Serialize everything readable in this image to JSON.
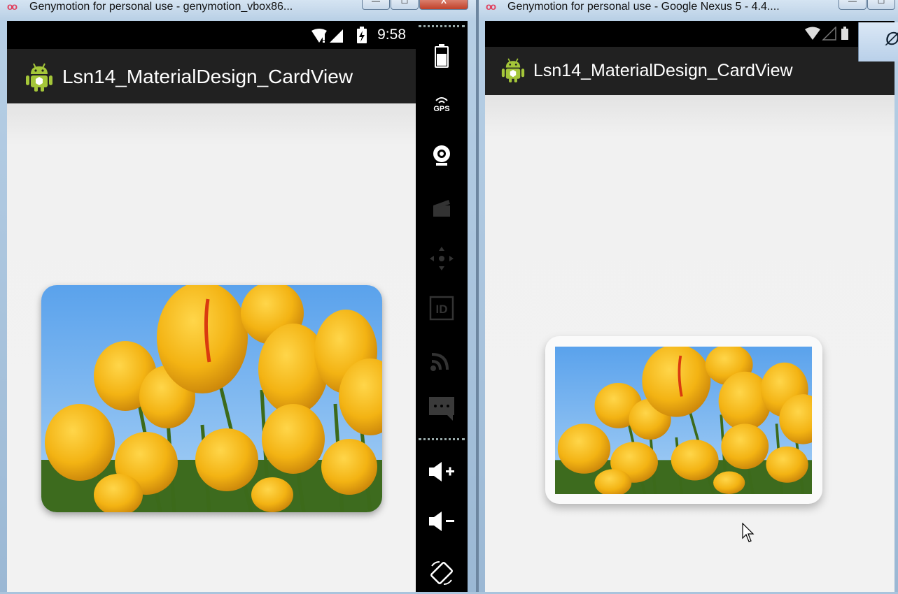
{
  "left_window": {
    "title": "Genymotion for personal use - genymotion_vbox86...",
    "controls": {
      "minimize": "—",
      "maximize": "☐",
      "close": "X"
    },
    "status_time": "9:58",
    "app_title": "Lsn14_MaterialDesign_CardView"
  },
  "right_window": {
    "title": "Genymotion for personal use - Google Nexus 5 - 4.4....",
    "controls": {
      "minimize": "—",
      "maximize": "☐"
    },
    "app_title": "Lsn14_MaterialDesign_CardView",
    "corner_glyph": "Ø"
  },
  "sidebar": {
    "items": [
      "battery-icon",
      "gps-icon",
      "webcam-icon",
      "capture-icon",
      "dpad-icon",
      "device-id-icon",
      "cast-icon",
      "sms-icon",
      "volume-up-icon",
      "volume-down-icon",
      "rotate-icon"
    ],
    "gps_label": "GPS",
    "id_label": "ID"
  },
  "colors": {
    "action_bar": "#212121",
    "status_bar": "#000000",
    "screen_bg": "#f0f0f0",
    "android_green": "#a4c639"
  }
}
